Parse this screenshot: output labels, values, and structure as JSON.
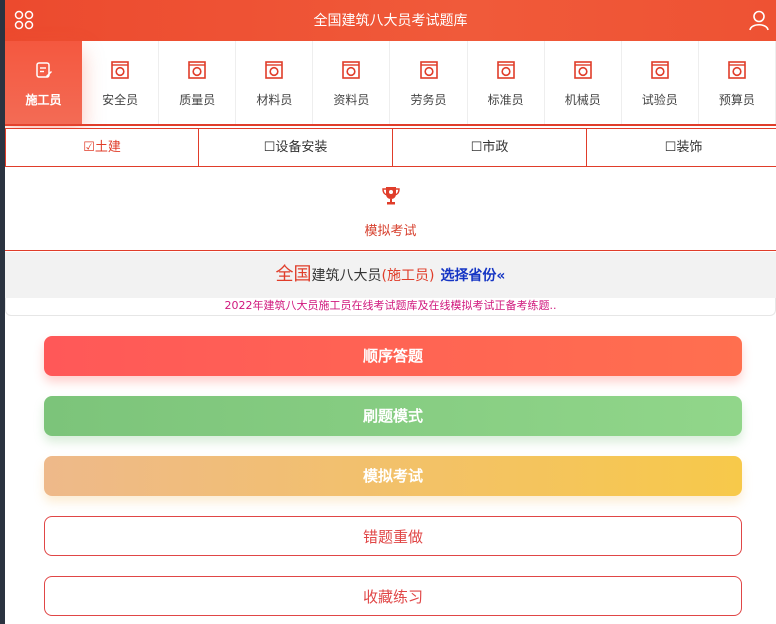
{
  "header": {
    "title": "全国建筑八大员考试题库",
    "menu_icon": "grid-icon",
    "user_icon": "user-icon"
  },
  "categories": [
    {
      "label": "施工员",
      "active": true
    },
    {
      "label": "安全员"
    },
    {
      "label": "质量员"
    },
    {
      "label": "材料员"
    },
    {
      "label": "资料员"
    },
    {
      "label": "劳务员"
    },
    {
      "label": "标准员"
    },
    {
      "label": "机械员"
    },
    {
      "label": "试验员"
    },
    {
      "label": "预算员"
    }
  ],
  "subtabs": [
    {
      "label": "☑土建",
      "active": true
    },
    {
      "label": "☐设备安装"
    },
    {
      "label": "☐市政"
    },
    {
      "label": "☐装饰"
    }
  ],
  "mock_exam": {
    "label": "模拟考试"
  },
  "info": {
    "national": "全国",
    "middle": "建筑八大员",
    "position": "(施工员)",
    "select_province": "选择省份«"
  },
  "notice": "2022年建筑八大员施工员在线考试题库及在线模拟考试正备考练题..",
  "buttons": {
    "sequential": "顺序答题",
    "practice": "刷题模式",
    "mock": "模拟考试",
    "wrong_redo": "错题重做",
    "favorites": "收藏练习"
  },
  "colors": {
    "accent": "#e03d2a",
    "notice": "#d0187d",
    "province_link": "#1535c4"
  }
}
